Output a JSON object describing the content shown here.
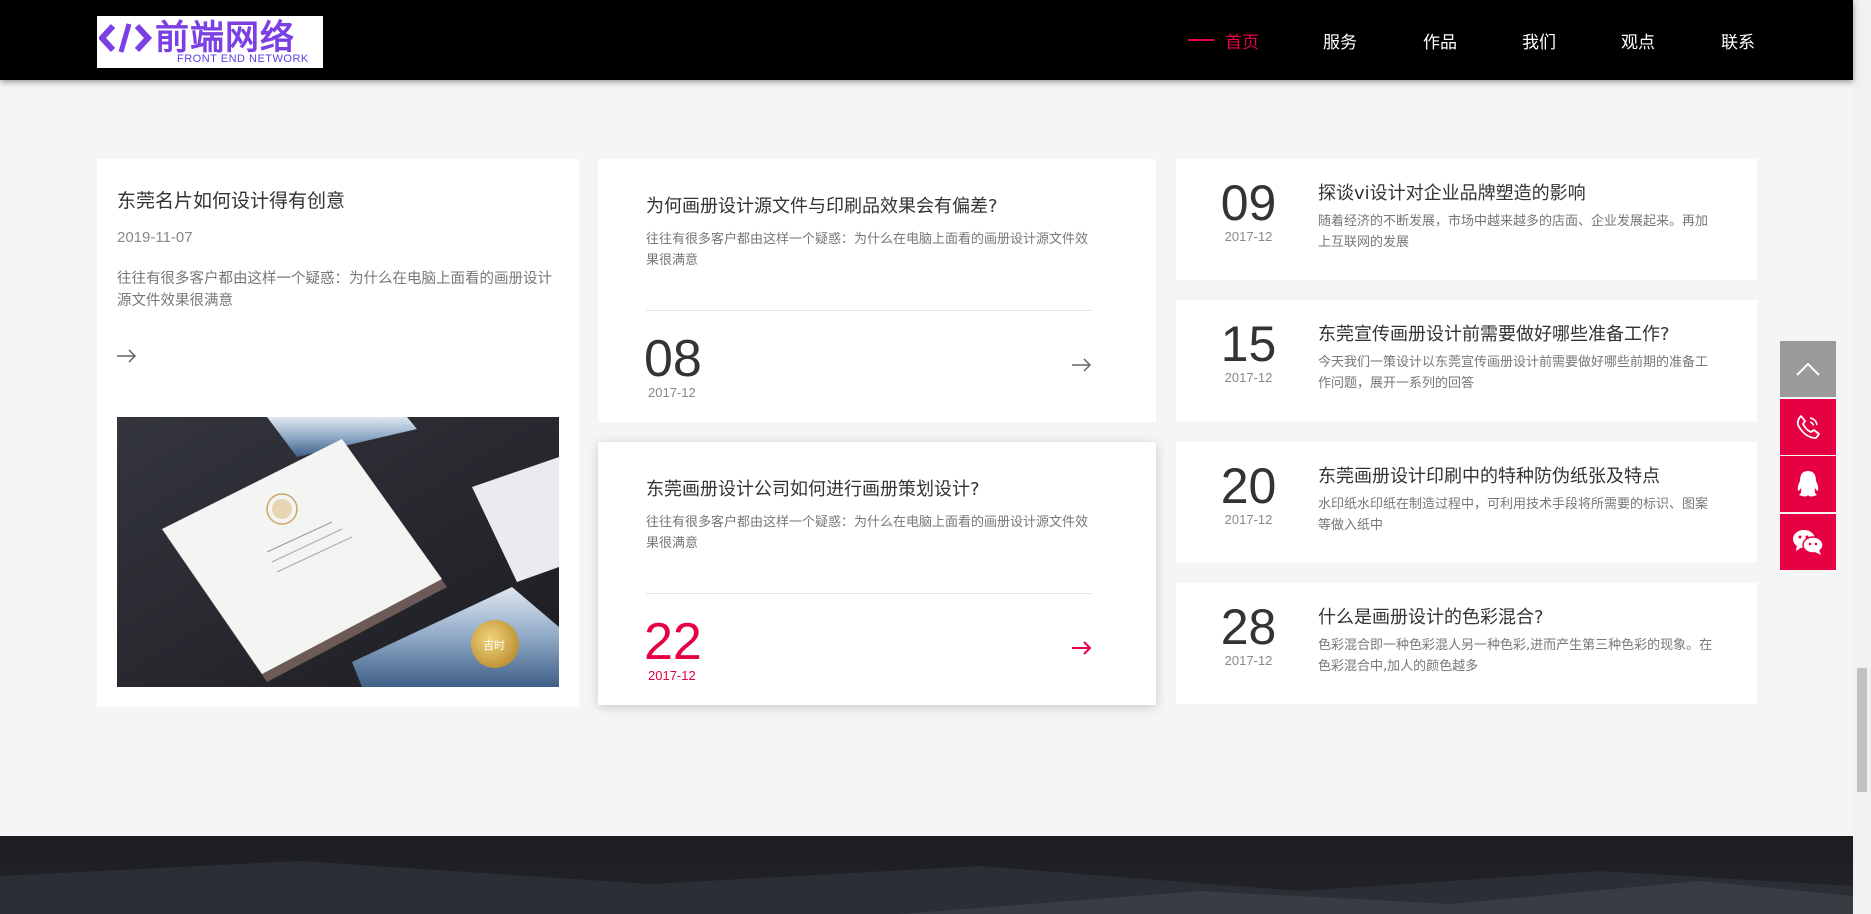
{
  "logo": {
    "cn_text": "前端网络",
    "en_text": "FRONT END NETWORK"
  },
  "nav": {
    "items": [
      {
        "label": "首页",
        "active": true
      },
      {
        "label": "服务",
        "active": false
      },
      {
        "label": "作品",
        "active": false
      },
      {
        "label": "我们",
        "active": false
      },
      {
        "label": "观点",
        "active": false
      },
      {
        "label": "联系",
        "active": false
      }
    ]
  },
  "featured": {
    "title": "东莞名片如何设计得有创意",
    "date": "2019-11-07",
    "desc": "往往有很多客户都由这样一个疑惑：为什么在电脑上面看的画册设计源文件效果很满意"
  },
  "middle": [
    {
      "title": "为何画册设计源文件与印刷品效果会有偏差?",
      "desc": "往往有很多客户都由这样一个疑惑：为什么在电脑上面看的画册设计源文件效果很满意",
      "day": "08",
      "ym": "2017-12"
    },
    {
      "title": "东莞画册设计公司如何进行画册策划设计?",
      "desc": "往往有很多客户都由这样一个疑惑：为什么在电脑上面看的画册设计源文件效果很满意",
      "day": "22",
      "ym": "2017-12"
    }
  ],
  "right": [
    {
      "day": "09",
      "ym": "2017-12",
      "title": "探谈vi设计对企业品牌塑造的影响",
      "desc": "随着经济的不断发展，市场中越来越多的店面、企业发展起来。再加上互联网的发展"
    },
    {
      "day": "15",
      "ym": "2017-12",
      "title": "东莞宣传画册设计前需要做好哪些准备工作?",
      "desc": "今天我们一策设计以东莞宣传画册设计前需要做好哪些前期的准备工作问题，展开一系列的回答"
    },
    {
      "day": "20",
      "ym": "2017-12",
      "title": "东莞画册设计印刷中的特种防伪纸张及特点",
      "desc": "水印纸水印纸在制造过程中，可利用技术手段将所需要的标识、图案等做入纸中"
    },
    {
      "day": "28",
      "ym": "2017-12",
      "title": "什么是画册设计的色彩混合?",
      "desc": "色彩混合即一种色彩混人另一种色彩,进而产生第三种色彩的现象。在色彩混合中,加人的颜色越多"
    }
  ],
  "colors": {
    "accent": "#e60044",
    "header_bg": "#000000",
    "page_bg": "#f5f5f5",
    "logo_purple": "#7b3fe4"
  },
  "icons": {
    "back_to_top": "chevron-up-icon",
    "phone": "phone-icon",
    "qq": "qq-icon",
    "wechat": "wechat-icon",
    "arrow": "arrow-right-icon"
  }
}
